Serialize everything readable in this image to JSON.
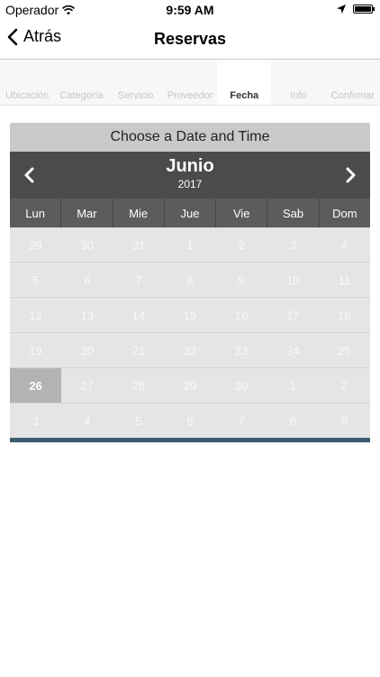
{
  "status": {
    "carrier": "Operador",
    "time": "9:59 AM"
  },
  "nav": {
    "back_label": "Atrás",
    "title": "Reservas"
  },
  "steps": [
    {
      "label": "Ubicación",
      "active": false
    },
    {
      "label": "Categoría",
      "active": false
    },
    {
      "label": "Servicio",
      "active": false
    },
    {
      "label": "Proveedor",
      "active": false
    },
    {
      "label": "Fecha",
      "active": true
    },
    {
      "label": "Info",
      "active": false
    },
    {
      "label": "Confirmar",
      "active": false
    }
  ],
  "calendar": {
    "header": "Choose a Date and Time",
    "month": "Junio",
    "year": "2017",
    "weekdays": [
      "Lun",
      "Mar",
      "Mie",
      "Jue",
      "Vie",
      "Sab",
      "Dom"
    ],
    "weeks": [
      [
        "29",
        "30",
        "31",
        "1",
        "2",
        "3",
        "4"
      ],
      [
        "5",
        "6",
        "7",
        "8",
        "9",
        "10",
        "11"
      ],
      [
        "12",
        "13",
        "14",
        "15",
        "16",
        "17",
        "18"
      ],
      [
        "19",
        "20",
        "21",
        "22",
        "23",
        "24",
        "25"
      ],
      [
        "26",
        "27",
        "28",
        "29",
        "30",
        "1",
        "2"
      ],
      [
        "3",
        "4",
        "5",
        "6",
        "7",
        "8",
        "9"
      ]
    ],
    "selected": {
      "week": 4,
      "day": 0
    }
  },
  "colors": {
    "accent_footer": "#3e5a6e",
    "month_bar": "#4b4b4b",
    "weekday_bar": "#5c5c5c"
  }
}
